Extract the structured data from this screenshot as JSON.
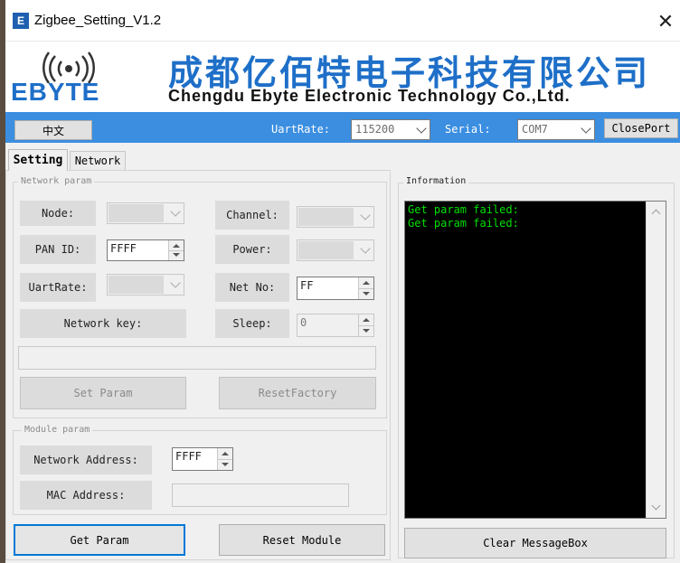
{
  "window": {
    "title": "Zigbee_Setting_V1.2",
    "icon_letter": "E",
    "close_glyph": "✕"
  },
  "banner": {
    "logo_text": "EBYTE",
    "company_cn": "成都亿佰特电子科技有限公司",
    "company_en": "Chengdu Ebyte Electronic Technology Co.,Ltd.",
    "brand_color": "#1e6fc8"
  },
  "toolbar": {
    "language_button": "中文",
    "uart_rate_label": "UartRate:",
    "uart_rate_value": "115200",
    "serial_label": "Serial:",
    "serial_value": "COM7",
    "close_port_button": "ClosePort",
    "bar_color": "#3b8ee0"
  },
  "tabs": [
    {
      "label": "Setting",
      "active": true
    },
    {
      "label": "Network",
      "active": false
    }
  ],
  "network_param": {
    "group_title": "Network param",
    "node_label": "Node:",
    "node_value": "",
    "channel_label": "Channel:",
    "channel_value": "",
    "pan_id_label": "PAN ID:",
    "pan_id_value": "FFFF",
    "power_label": "Power:",
    "power_value": "",
    "uart_rate_label": "UartRate:",
    "uart_rate_value": "",
    "net_no_label": "Net No:",
    "net_no_value": "FF",
    "network_key_label": "Network key:",
    "network_key_value": "",
    "sleep_label": "Sleep:",
    "sleep_value": "0",
    "set_param_button": "Set Param",
    "reset_factory_button": "ResetFactory"
  },
  "module_param": {
    "group_title": "Module param",
    "network_address_label": "Network Address:",
    "network_address_value": "FFFF",
    "mac_address_label": "MAC Address:",
    "mac_address_value": ""
  },
  "actions": {
    "get_param_button": "Get Param",
    "reset_module_button": "Reset Module",
    "clear_messagebox_button": "Clear MessageBox"
  },
  "information": {
    "group_title": "Information",
    "lines": [
      "Get param failed:",
      "Get param failed:"
    ],
    "text_color": "#00e000"
  }
}
